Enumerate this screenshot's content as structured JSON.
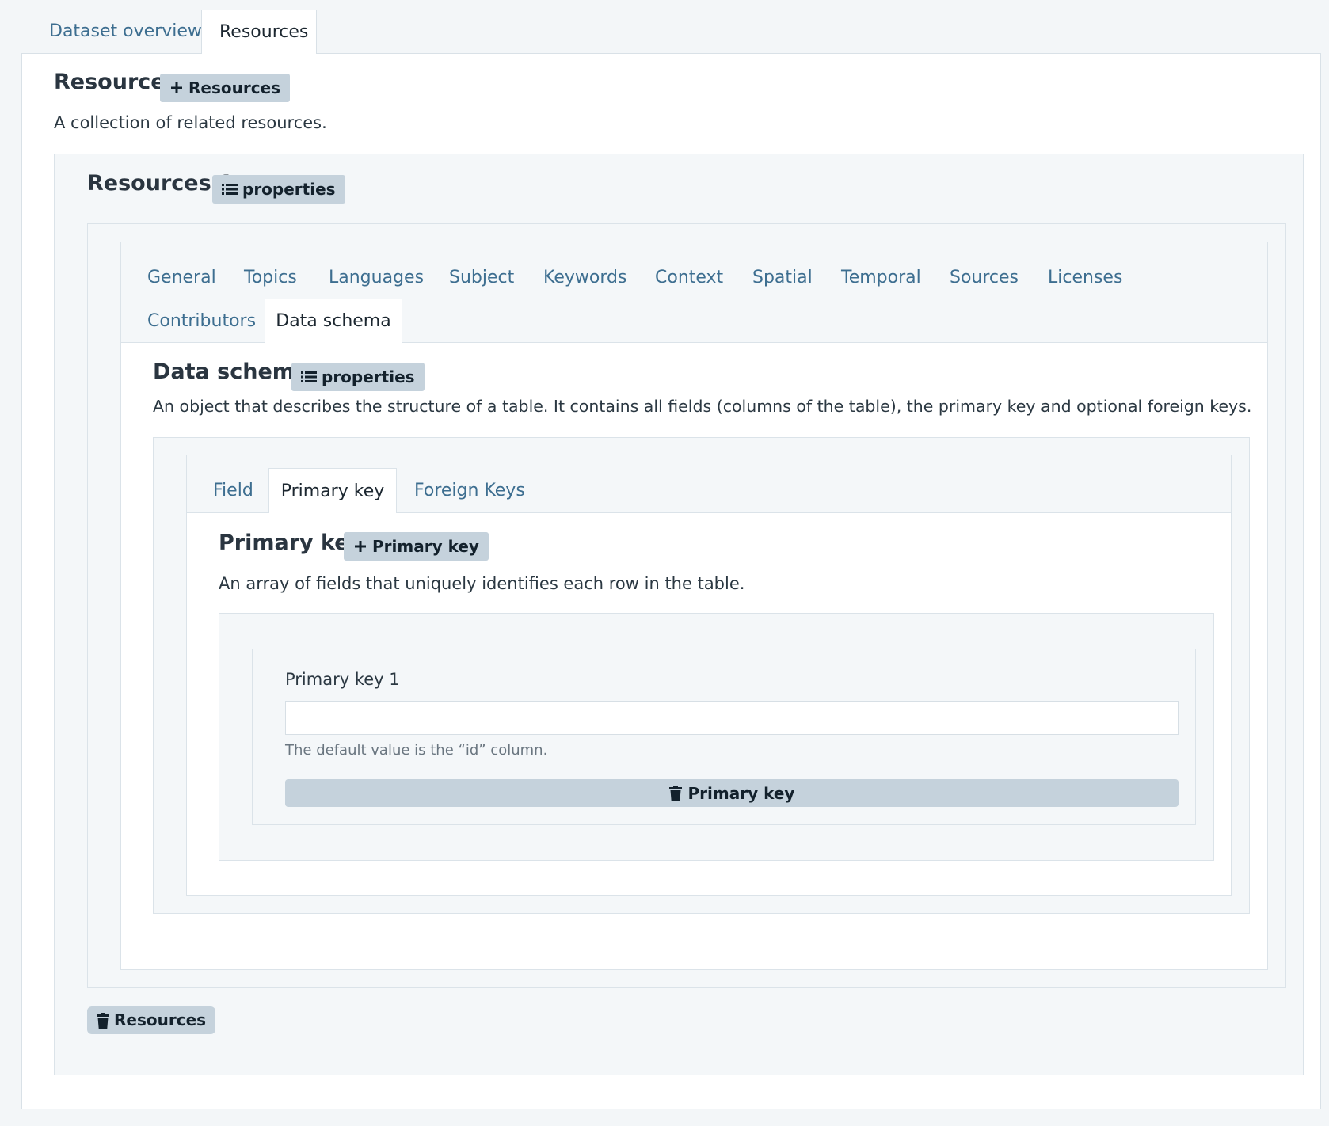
{
  "top_tabs": [
    {
      "label": "Dataset overview",
      "active": false
    },
    {
      "label": "Resources",
      "active": true
    }
  ],
  "resources_section": {
    "title": "Resources",
    "add_button": "Resources",
    "description": "A collection of related resources."
  },
  "resource_item": {
    "title": "Resources 1",
    "properties_button": "properties",
    "remove_button": "Resources"
  },
  "resource_tabs_row1": [
    "General",
    "Topics",
    "Languages",
    "Subject",
    "Keywords",
    "Context",
    "Spatial",
    "Temporal",
    "Sources",
    "Licenses"
  ],
  "resource_tabs_row2": [
    "Contributors",
    "Data schema"
  ],
  "active_resource_tab": "Data schema",
  "data_schema": {
    "title": "Data schema",
    "properties_button": "properties",
    "description": "An object that describes the structure of a table. It contains all fields (columns of the table), the primary key and optional foreign keys."
  },
  "schema_tabs": [
    "Field",
    "Primary key",
    "Foreign Keys"
  ],
  "active_schema_tab": "Primary key",
  "primary_key": {
    "title": "Primary key",
    "add_button": "Primary key",
    "description": "An array of fields that uniquely identifies each row in the table.",
    "item_label": "Primary key 1",
    "item_value": "",
    "help_text": "The default value is the “id” column.",
    "remove_button": "Primary key"
  },
  "icons": {
    "plus": "plus-icon",
    "list": "list-icon",
    "trash": "trash-icon"
  },
  "colors": {
    "link": "#3d6e90",
    "badge_bg": "#c5d2dc",
    "page_bg": "#f3f6f8"
  }
}
